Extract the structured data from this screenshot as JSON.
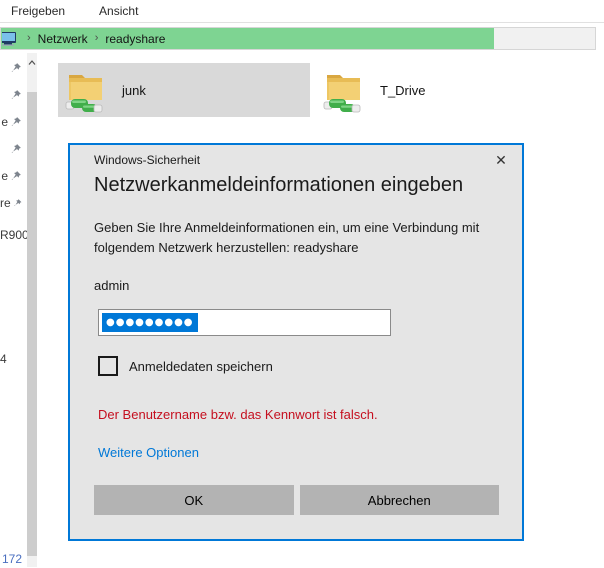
{
  "ribbon": {
    "tabs": [
      {
        "label": "Freigeben"
      },
      {
        "label": "Ansicht"
      }
    ]
  },
  "address_bar": {
    "crumbs": [
      {
        "label": "Netzwerk"
      },
      {
        "label": "readyshare"
      }
    ],
    "separator": "›",
    "progress_percent": 83,
    "progress_color": "#7ed492"
  },
  "sidebar": {
    "pins": [
      {
        "fragment": ""
      },
      {
        "fragment": ""
      },
      {
        "fragment": "e"
      },
      {
        "fragment": ""
      },
      {
        "fragment": "e"
      },
      {
        "fragment": "re"
      }
    ],
    "texts": [
      {
        "label": "R900"
      },
      {
        "label": "4"
      }
    ]
  },
  "content": {
    "items": [
      {
        "name": "junk",
        "selected": true
      },
      {
        "name": "T_Drive",
        "selected": false
      }
    ]
  },
  "dialog": {
    "title": "Windows-Sicherheit",
    "close_glyph": "✕",
    "heading": "Netzwerkanmeldeinformationen eingeben",
    "body": "Geben Sie Ihre Anmeldeinformationen ein, um eine Verbindung mit folgendem Netzwerk herzustellen: readyshare",
    "username": "admin",
    "password_masked": "●●●●●●●●●",
    "checkbox_label": "Anmeldedaten speichern",
    "checkbox_checked": false,
    "error_text": "Der Benutzername bzw. das Kennwort ist falsch.",
    "link_label": "Weitere Optionen",
    "ok_label": "OK",
    "cancel_label": "Abbrechen"
  },
  "status": {
    "fragment": "172"
  },
  "colors": {
    "accent_blue": "#0078d7",
    "progress_green": "#7ed492",
    "error_red": "#c50f1f",
    "selection_gray": "#d9d9d9",
    "dialog_bg": "#e5e5e5",
    "button_gray": "#b3b3b3"
  }
}
